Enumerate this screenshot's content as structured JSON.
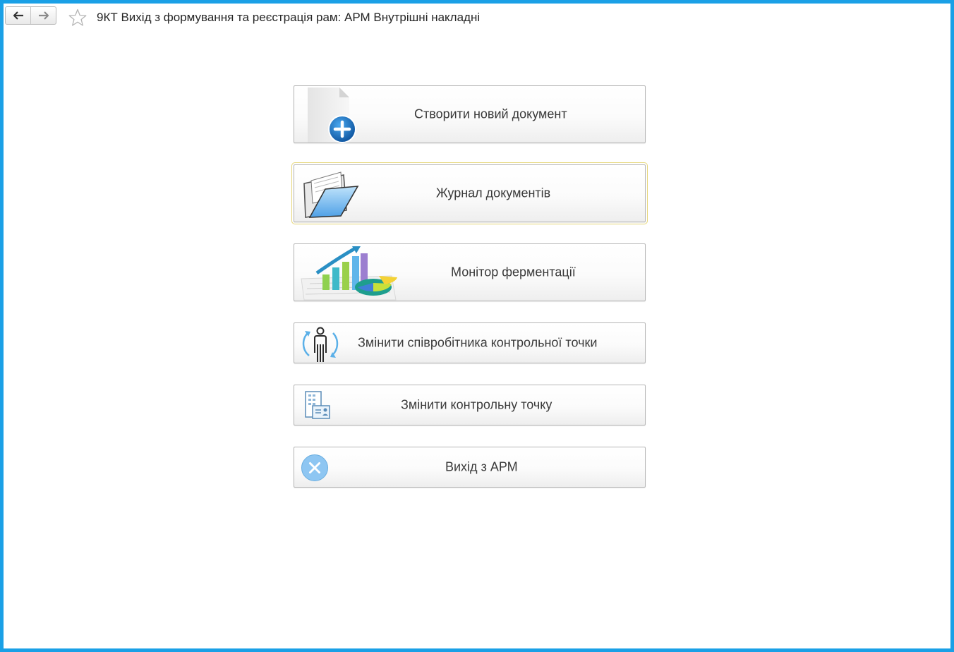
{
  "window": {
    "title": "9КТ Вихід з формування та реєстрація рам: АРМ Внутрішні накладні"
  },
  "nav": {
    "back_icon": "arrow-left-icon",
    "forward_icon": "arrow-right-icon",
    "favorite_icon": "star-outline-icon"
  },
  "menu": [
    {
      "id": "create-document",
      "label": "Створити новий документ",
      "icon": "new-document-plus-icon"
    },
    {
      "id": "documents-journal",
      "label": "Журнал документів",
      "icon": "open-folder-icon"
    },
    {
      "id": "fermentation-monitor",
      "label": "Монітор ферментації",
      "icon": "charts-icon"
    },
    {
      "id": "change-employee",
      "label": "Змінити співробітника контрольної точки",
      "icon": "person-refresh-icon"
    },
    {
      "id": "change-checkpoint",
      "label": "Змінити контрольну точку",
      "icon": "building-card-icon"
    },
    {
      "id": "exit",
      "label": "Вихід з АРМ",
      "icon": "close-circle-icon"
    }
  ],
  "colors": {
    "frame_border": "#1aa0e6",
    "focus_outline": "#e6d67a",
    "exit_icon": "#8ec6f2"
  }
}
